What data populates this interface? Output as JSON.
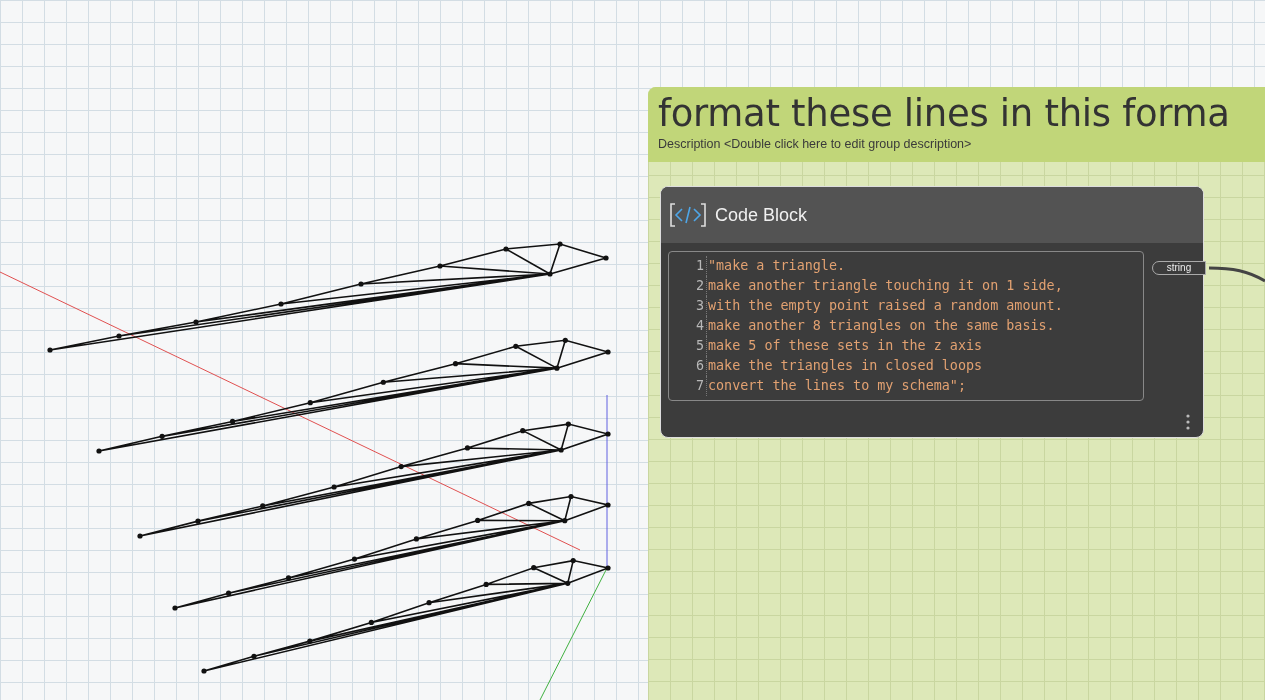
{
  "group": {
    "title": "format these lines in this forma",
    "description": "Description <Double click here to edit group description>"
  },
  "node": {
    "title": "Code Block",
    "output_port": "string",
    "code_lines": [
      {
        "number": "1",
        "text": "\"make a triangle."
      },
      {
        "number": "2",
        "text": "make another triangle touching it on 1 side,"
      },
      {
        "number": "3",
        "text": "with the empty point raised a random amount."
      },
      {
        "number": "4",
        "text": "make another 8 triangles on the same basis."
      },
      {
        "number": "5",
        "text": "make 5 of these sets in the z axis"
      },
      {
        "number": "6",
        "text": "make the triangles in closed loops"
      },
      {
        "number": "7",
        "text": "convert the lines to my schema\";"
      }
    ]
  }
}
